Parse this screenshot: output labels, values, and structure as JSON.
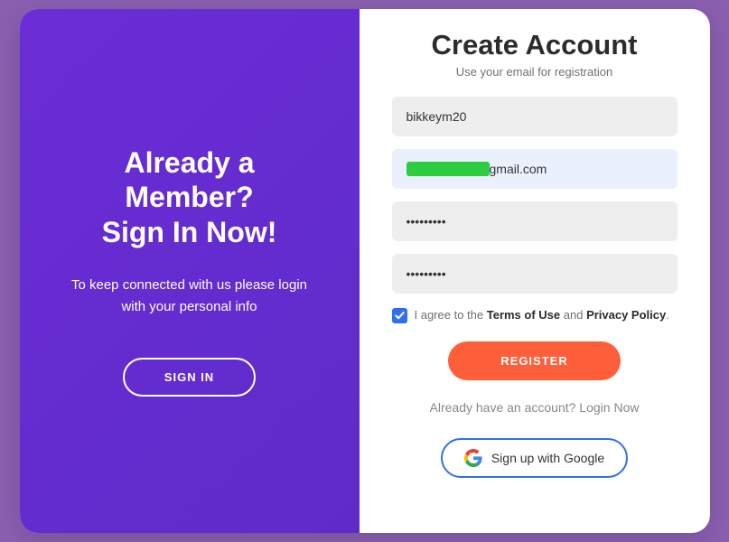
{
  "left": {
    "title_line1": "Already a",
    "title_line2": "Member?",
    "title_line3": "Sign In Now!",
    "desc_line1": "To keep connected with us please login",
    "desc_line2": "with your personal info",
    "signin_label": "SIGN IN"
  },
  "right": {
    "title": "Create Account",
    "subtitle": "Use your email for registration",
    "name_value": "bikkeym20",
    "email_value": "                    @gmail.com",
    "password_value": "•••••••••",
    "confirm_value": "•••••••••",
    "agree_prefix": "I agree to the ",
    "terms_label": "Terms of Use",
    "agree_mid": " and ",
    "privacy_label": "Privacy Policy",
    "agree_suffix": ".",
    "register_label": "REGISTER",
    "already_text": "Already have an account? Login Now",
    "google_label": "Sign up with Google"
  }
}
